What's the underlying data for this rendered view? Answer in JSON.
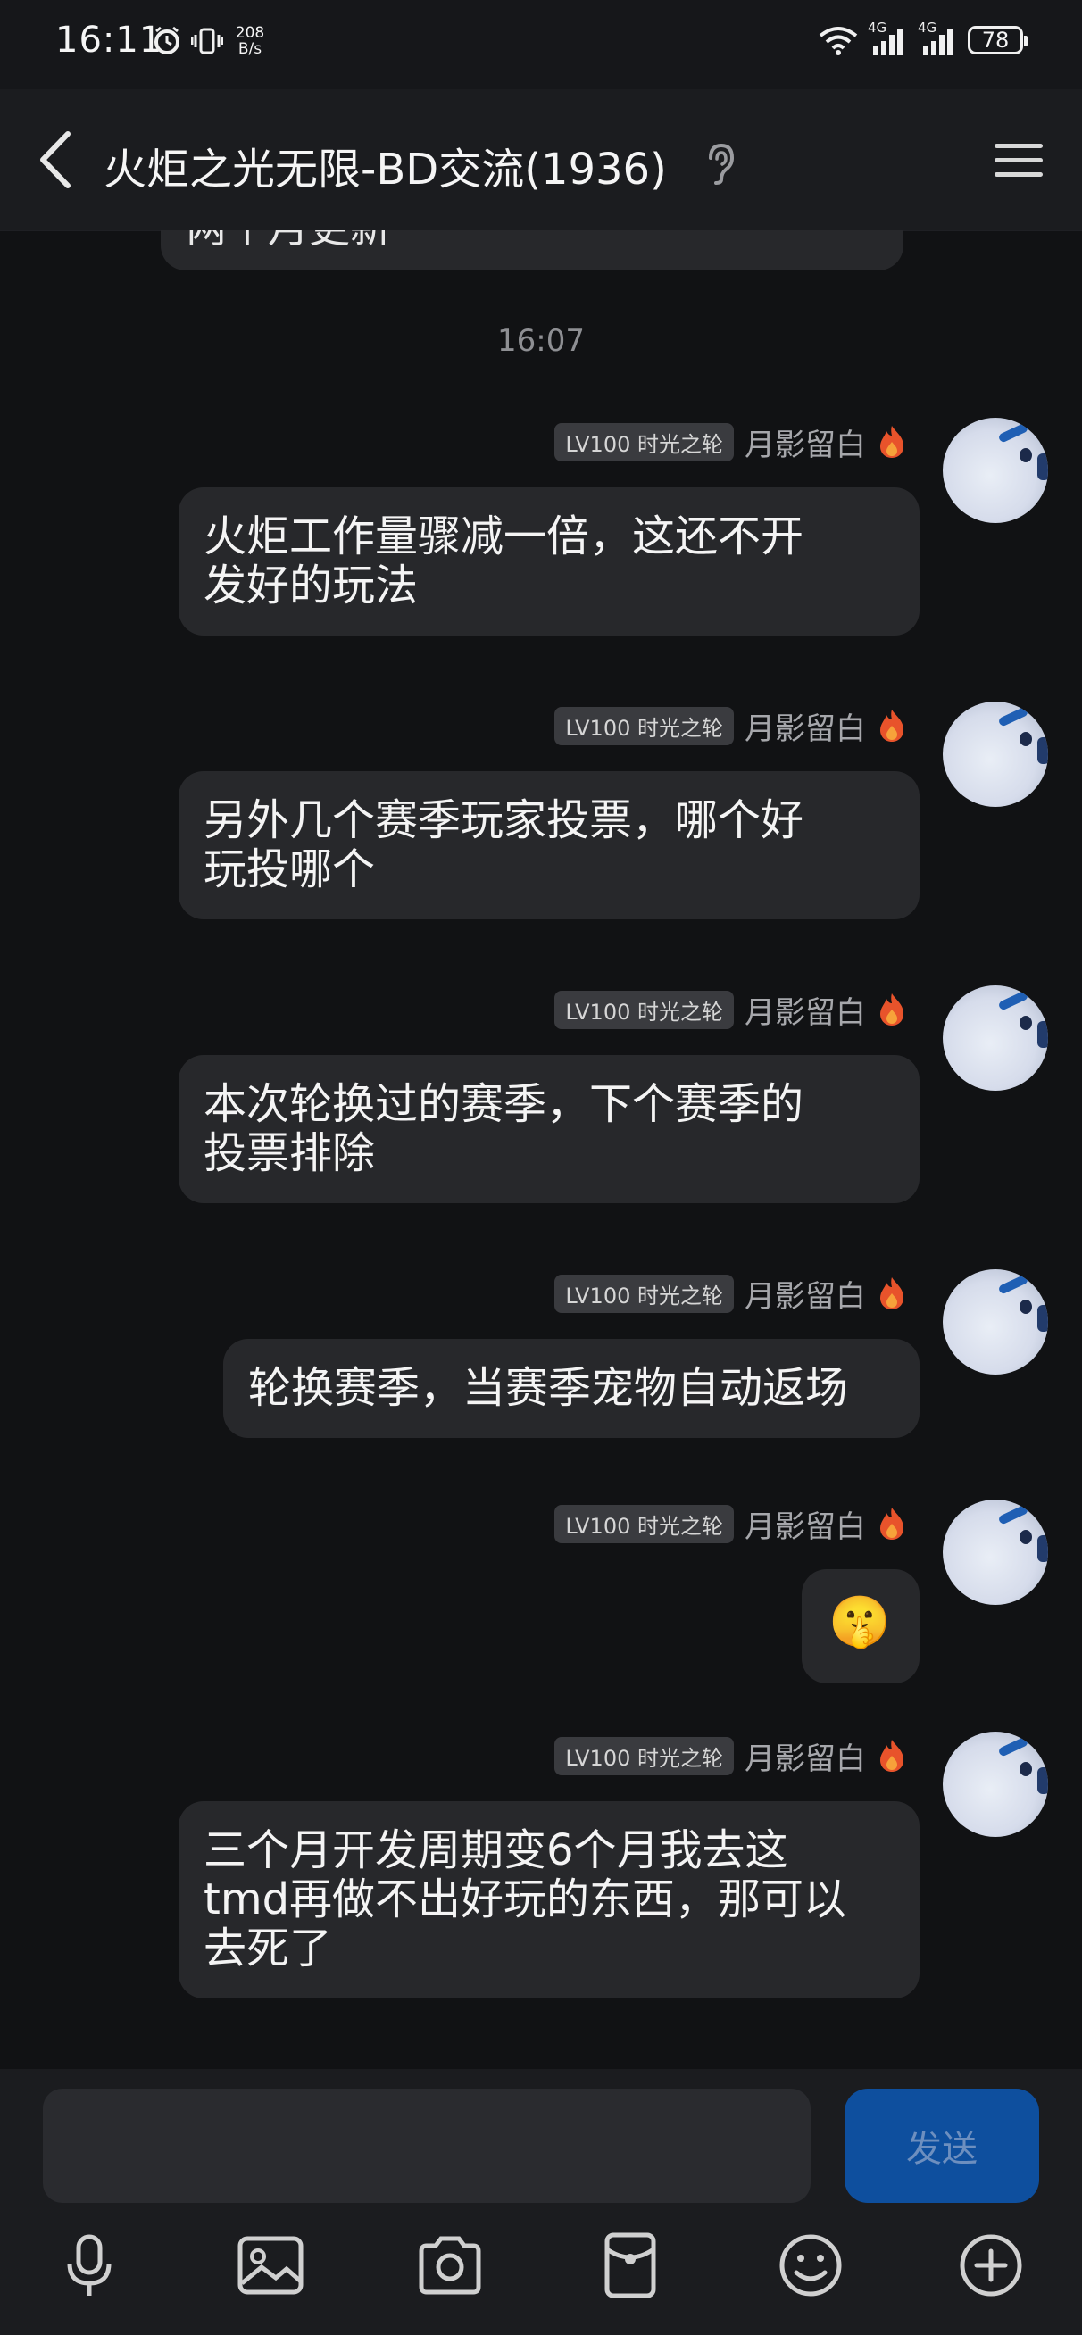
{
  "status_bar": {
    "time": "16:11",
    "net_speed_value": "208",
    "net_speed_unit": "B/s",
    "signal_1": "4G",
    "signal_2": "4G",
    "battery": "78"
  },
  "header": {
    "title": "火炬之光无限-BD交流(1936)"
  },
  "chat": {
    "previous_message_partial": "两个月更新",
    "timestamp": "16:07",
    "messages": [
      {
        "badge": "LV100 时光之轮",
        "sender": "月影留白",
        "text_line1": "火炬工作量骤减一倍，这还不开",
        "text_line2": "发好的玩法"
      },
      {
        "badge": "LV100 时光之轮",
        "sender": "月影留白",
        "text_line1": "另外几个赛季玩家投票，哪个好",
        "text_line2": "玩投哪个"
      },
      {
        "badge": "LV100 时光之轮",
        "sender": "月影留白",
        "text_line1": "本次轮换过的赛季，下个赛季的",
        "text_line2": "投票排除"
      },
      {
        "badge": "LV100 时光之轮",
        "sender": "月影留白",
        "text_line1": "轮换赛季，当赛季宠物自动返场"
      },
      {
        "badge": "LV100 时光之轮",
        "sender": "月影留白",
        "text_line1": "🤫"
      },
      {
        "badge": "LV100 时光之轮",
        "sender": "月影留白",
        "text_line1": "三个月开发周期变6个月我去这",
        "text_line2": "tmd再做不出好玩的东西，那可以",
        "text_line3": "去死了"
      }
    ]
  },
  "composer": {
    "input_value": "",
    "send_label": "发送"
  },
  "colors": {
    "background": "#111214",
    "bubble": "#27282b",
    "send_button": "#0e4f9e",
    "fire": "#e8532b"
  }
}
